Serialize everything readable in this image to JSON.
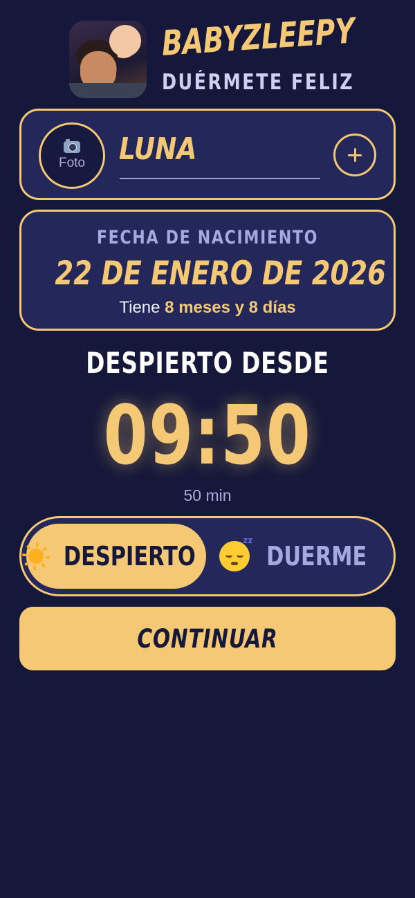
{
  "header": {
    "app_name": "BABYZLEEPY",
    "tagline": "DUÉRMETE FELIZ",
    "logo_icon": "parent-and-baby-logo"
  },
  "baby": {
    "photo_icon": "camera-icon",
    "photo_label": "Foto",
    "name": "LUNA",
    "add_icon": "plus-icon"
  },
  "birth": {
    "label": "FECHA DE NACIMIENTO",
    "date": "22 DE ENERO DE 2026",
    "age_prefix": "Tiene",
    "age_value": "8 meses y 8 días"
  },
  "awake": {
    "label": "DESPIERTO DESDE",
    "time": "09:50",
    "elapsed": "50 min"
  },
  "toggle": {
    "awake_label": "DESPIERTO",
    "awake_icon": "sun-icon",
    "sleep_label": "DUERME",
    "sleep_icon": "sleeping-face-icon",
    "selected": "awake"
  },
  "actions": {
    "continue_label": "CONTINUAR"
  },
  "colors": {
    "background": "#15183a",
    "card": "#23275a",
    "accent": "#f4c874",
    "muted": "#a6a8e0"
  }
}
